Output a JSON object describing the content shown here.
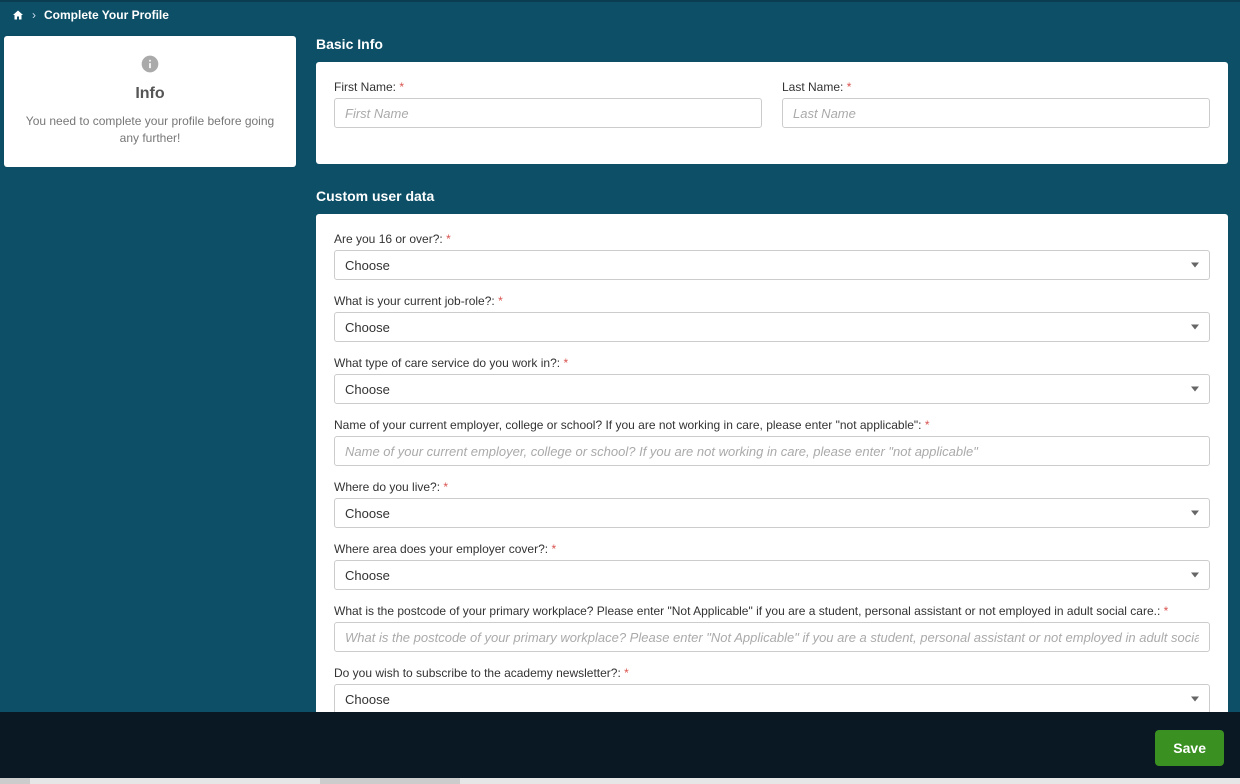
{
  "breadcrumb": {
    "crumb": "Complete Your Profile"
  },
  "info": {
    "title": "Info",
    "text": "You need to complete your profile before going any further!"
  },
  "basic": {
    "heading": "Basic Info",
    "first_name_label": "First Name:",
    "first_name_placeholder": "First Name",
    "first_name_value": "",
    "last_name_label": "Last Name:",
    "last_name_placeholder": "Last Name",
    "last_name_value": ""
  },
  "custom": {
    "heading": "Custom user data",
    "fields": {
      "age": {
        "label": "Are you 16 or over?:",
        "value": "Choose"
      },
      "job": {
        "label": "What is your current job-role?:",
        "value": "Choose"
      },
      "service": {
        "label": "What type of care service do you work in?:",
        "value": "Choose"
      },
      "employer": {
        "label": "Name of your current employer, college or school? If you are not working in care, please enter \"not applicable\":",
        "placeholder": "Name of your current employer, college or school? If you are not working in care, please enter \"not applicable\"",
        "value": ""
      },
      "live": {
        "label": "Where do you live?:",
        "value": "Choose"
      },
      "area": {
        "label": "Where area does your employer cover?:",
        "value": "Choose"
      },
      "postcode": {
        "label": "What is the postcode of your primary workplace? Please enter \"Not Applicable\" if you are a student, personal assistant or not employed in adult social care.:",
        "placeholder": "What is the postcode of your primary workplace? Please enter \"Not Applicable\" if you are a student, personal assistant or not employed in adult social care.",
        "value": ""
      },
      "newsletter": {
        "label": "Do you wish to subscribe to the academy newsletter?:",
        "value": "Choose"
      }
    }
  },
  "footer": {
    "save": "Save"
  },
  "required_mark": "*"
}
